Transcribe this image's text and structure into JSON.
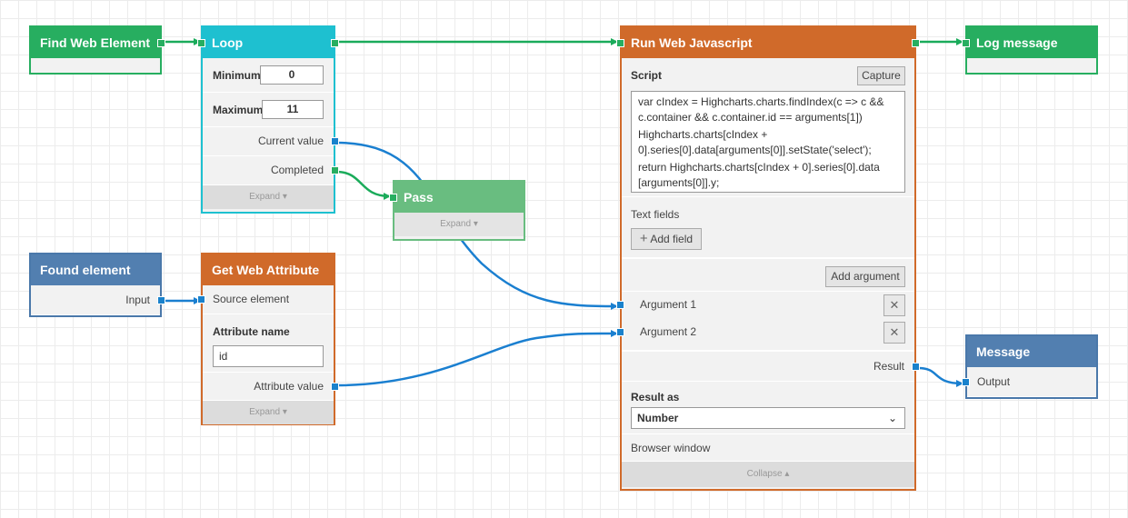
{
  "nodes": {
    "find_web_element": {
      "title": "Find Web Element"
    },
    "loop": {
      "title": "Loop",
      "minimum_label": "Minimum",
      "minimum_value": "0",
      "maximum_label": "Maximum",
      "maximum_value": "11",
      "current_value_label": "Current value",
      "completed_label": "Completed",
      "expand_label": "Expand"
    },
    "pass": {
      "title": "Pass",
      "expand_label": "Expand"
    },
    "found_element": {
      "title": "Found element",
      "input_label": "Input"
    },
    "get_web_attribute": {
      "title": "Get Web Attribute",
      "source_element_label": "Source element",
      "attribute_name_label": "Attribute name",
      "attribute_name_value": "id",
      "attribute_value_label": "Attribute value",
      "expand_label": "Expand"
    },
    "run_web_javascript": {
      "title": "Run Web Javascript",
      "script_label": "Script",
      "capture_label": "Capture",
      "script_lines": [
        "var cIndex = Highcharts.charts.findIndex(c => c && c.container && c.container.id == arguments[1])",
        "Highcharts.charts[cIndex + 0].series[0].data[arguments[0]].setState('select');",
        "return Highcharts.charts[cIndex + 0].series[0].data [arguments[0]].y;"
      ],
      "text_fields_label": "Text fields",
      "add_field_label": "Add field",
      "add_argument_label": "Add argument",
      "argument1_label": "Argument 1",
      "argument2_label": "Argument 2",
      "result_label": "Result",
      "result_as_label": "Result as",
      "result_as_value": "Number",
      "browser_window_label": "Browser window",
      "collapse_label": "Collapse"
    },
    "log_message": {
      "title": "Log message"
    },
    "message": {
      "title": "Message",
      "output_label": "Output"
    }
  },
  "colors": {
    "flow_wire": "#1aab5a",
    "data_wire": "#1a7fd0",
    "green_header": "#27ae60",
    "cyan_header": "#1ec0d0",
    "orange_header": "#d06a2a",
    "blue_header": "#527fb0",
    "light_green_header": "#69bd80"
  }
}
